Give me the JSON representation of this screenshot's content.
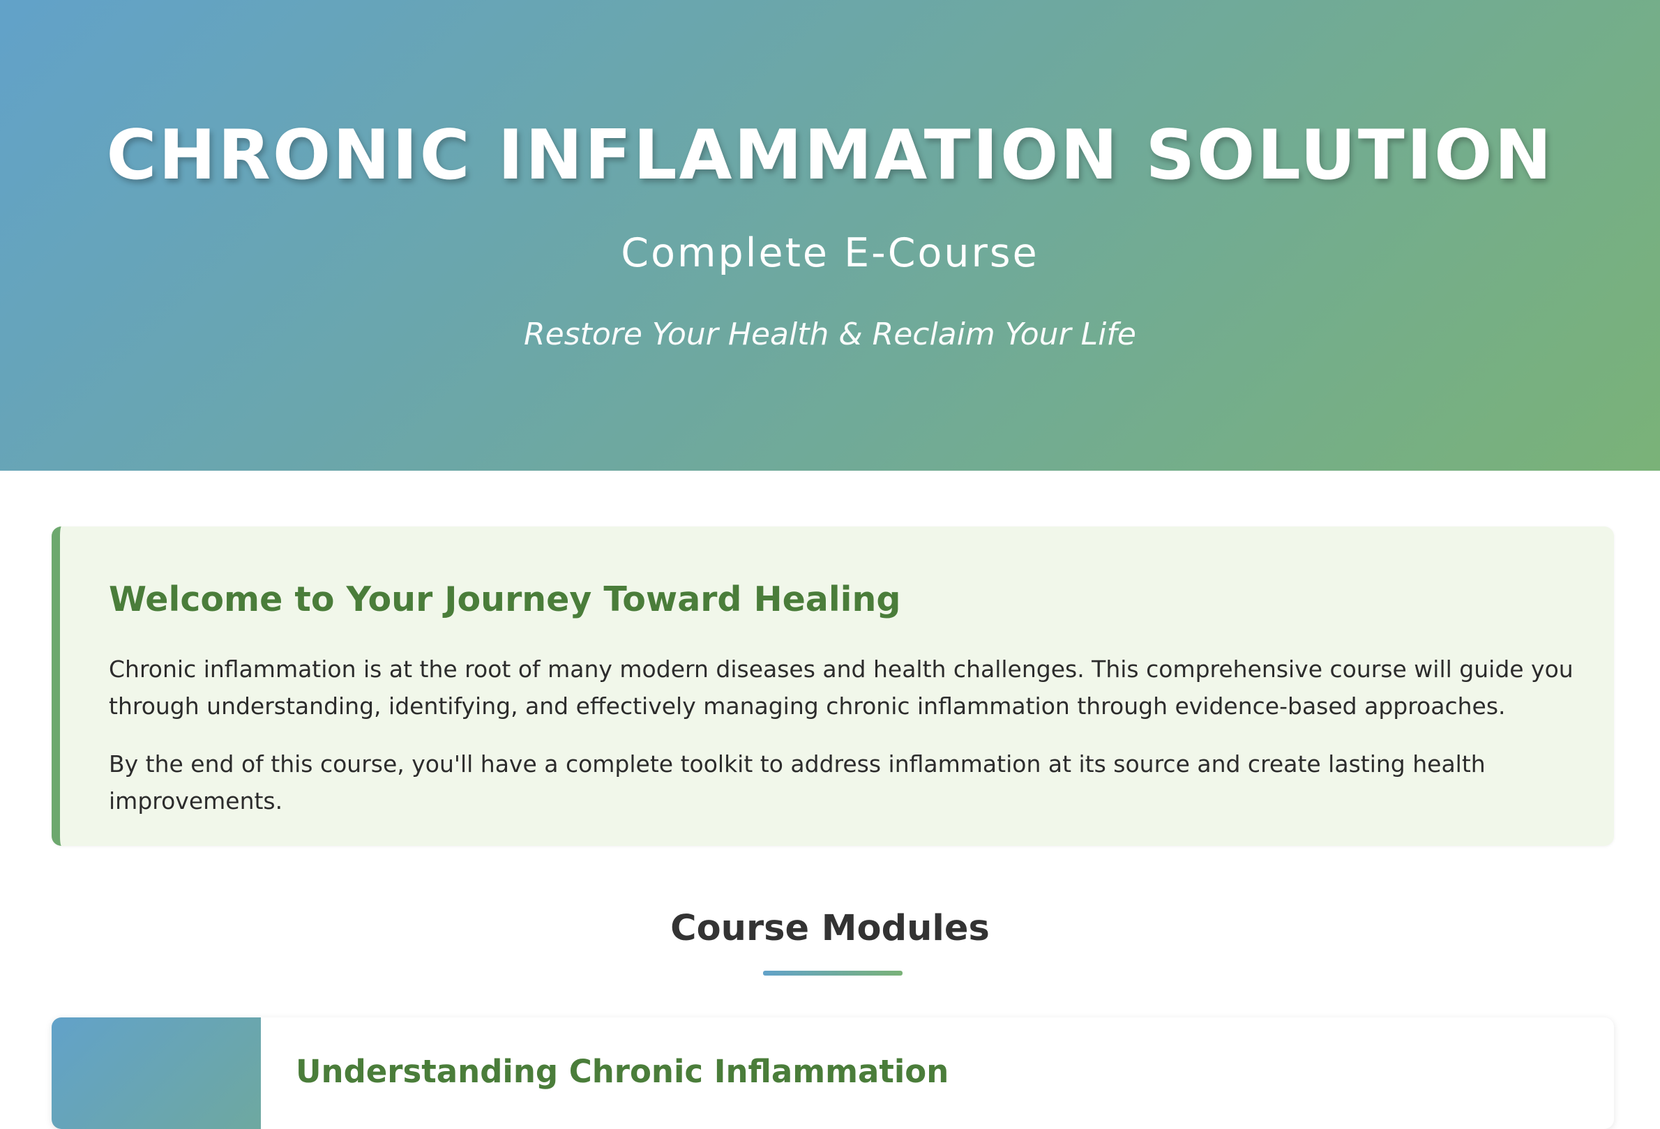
{
  "hero": {
    "title": "CHRONIC INFLAMMATION SOLUTION",
    "subtitle": "Complete E-Course",
    "tagline": "Restore Your Health & Reclaim Your Life"
  },
  "welcome": {
    "title": "Welcome to Your Journey Toward Healing",
    "paragraph_1": "Chronic inflammation is at the root of many modern diseases and health challenges. This comprehensive course will guide you through understanding, identifying, and effectively managing chronic inflammation through evidence-based approaches.",
    "paragraph_2": "By the end of this course, you'll have a complete toolkit to address inflammation at its source and create lasting health improvements."
  },
  "modules": {
    "heading": "Course Modules",
    "items": [
      {
        "title": "Understanding Chronic Inflammation"
      }
    ]
  },
  "colors": {
    "gradient_start": "#62a2c9",
    "gradient_end": "#7ab278",
    "welcome_bg": "#f1f7ea",
    "accent_green": "#4a7d3a"
  }
}
